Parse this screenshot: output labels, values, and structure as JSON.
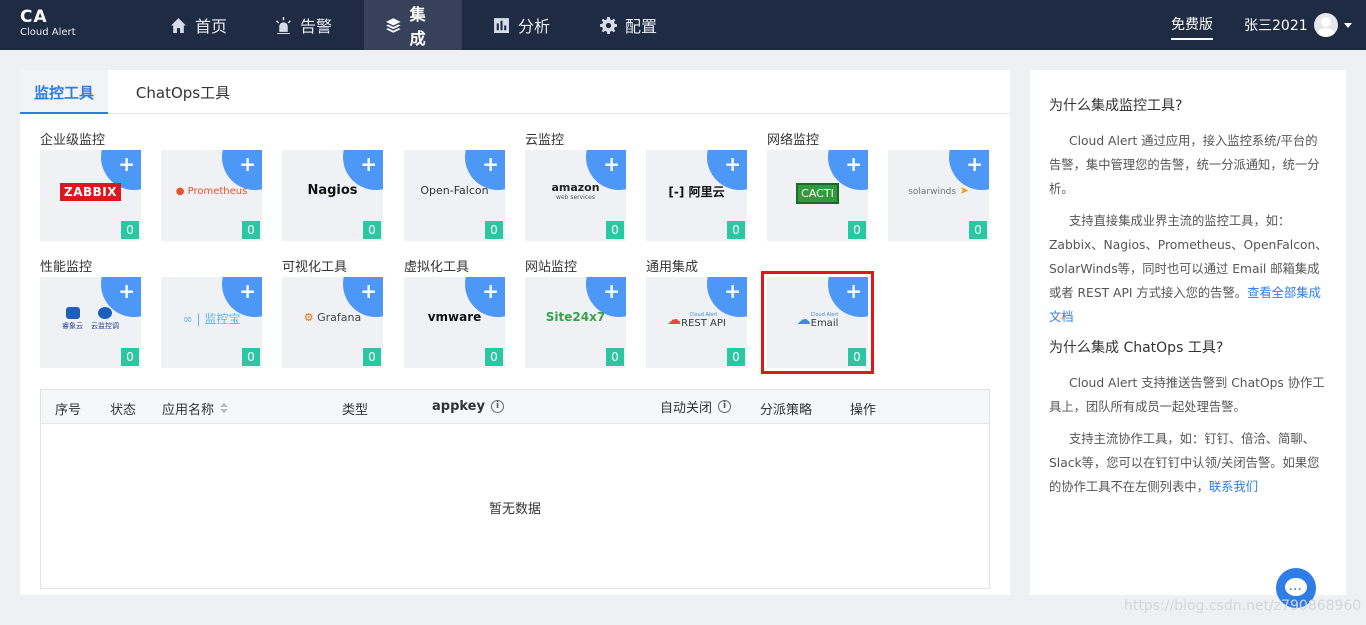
{
  "brand": {
    "short": "CA",
    "name": "Cloud Alert"
  },
  "nav": [
    {
      "label": "首页",
      "icon": "home-icon"
    },
    {
      "label": "告警",
      "icon": "alarm-icon"
    },
    {
      "label": "集成",
      "icon": "layers-icon",
      "active": true
    },
    {
      "label": "分析",
      "icon": "chart-icon"
    },
    {
      "label": "配置",
      "icon": "gear-icon"
    }
  ],
  "plan": "免费版",
  "user": "张三2021",
  "tabs": [
    "监控工具",
    "ChatOps工具"
  ],
  "categories": {
    "enterprise": "企业级监控",
    "cloud": "云监控",
    "network": "网络监控",
    "performance": "性能监控",
    "visualization": "可视化工具",
    "virtualization": "虚拟化工具",
    "website": "网站监控",
    "general": "通用集成"
  },
  "tools": [
    {
      "name": "ZABBIX",
      "count": "0"
    },
    {
      "name": "Prometheus",
      "count": "0"
    },
    {
      "name": "Nagios",
      "count": "0"
    },
    {
      "name": "Open-Falcon",
      "count": "0"
    },
    {
      "name": "amazon",
      "sub": "web services",
      "count": "0"
    },
    {
      "name": "阿里云",
      "count": "0"
    },
    {
      "name": "CACTI",
      "count": "0"
    },
    {
      "name": "solarwinds",
      "count": "0"
    },
    {
      "name": "睿象云",
      "name2": "云监控调",
      "count": "0"
    },
    {
      "name": "监控宝",
      "count": "0"
    },
    {
      "name": "Grafana",
      "count": "0"
    },
    {
      "name": "vmware",
      "count": "0"
    },
    {
      "name": "Site24x7",
      "count": "0"
    },
    {
      "name": "REST API",
      "sub": "Cloud Alert",
      "count": "0"
    },
    {
      "name": "Email",
      "sub": "Cloud Alert",
      "count": "0",
      "selected": true
    }
  ],
  "plus": "+",
  "table": {
    "headers": [
      "序号",
      "状态",
      "应用名称",
      "类型",
      "appkey",
      "自动关闭",
      "分派策略",
      "操作"
    ],
    "info_glyph": "i",
    "empty": "暂无数据"
  },
  "side": {
    "q1": "为什么集成监控工具?",
    "p1": "Cloud Alert 通过应用，接入监控系统/平台的告警，集中管理您的告警，统一分派通知，统一分析。",
    "p2": "支持直接集成业界主流的监控工具，如：Zabbix、Nagios、Prometheus、OpenFalcon、SolarWinds等，同时也可以通过 Email 邮箱集成或者 REST API 方式接入您的告警。",
    "link1": "查看全部集成文档",
    "q2": "为什么集成 ChatOps 工具?",
    "p3": "Cloud Alert 支持推送告警到 ChatOps 协作工具上，团队所有成员一起处理告警。",
    "p4": "支持主流协作工具，如：钉钉、倍洽、简聊、Slack等，您可以在钉钉中认领/关闭告警。如果您的协作工具不在左侧列表中，",
    "link2": "联系我们"
  },
  "chat_dots": "...",
  "watermark": "https://blog.csdn.net/z790868960",
  "colors": {
    "nav_bg": "#1f2b43",
    "accent": "#2d7de0",
    "count_badge": "#2cc7a2",
    "corner": "#4d97f7",
    "highlight": "#e01818"
  }
}
